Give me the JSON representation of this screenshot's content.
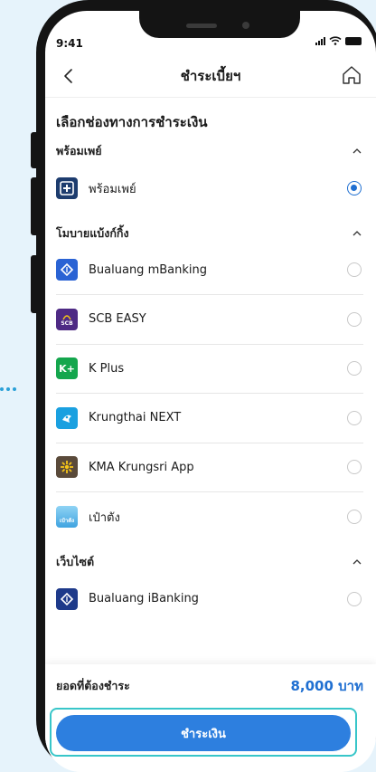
{
  "status": {
    "time": "9:41"
  },
  "nav": {
    "title": "ชำระเบี้ยฯ"
  },
  "page": {
    "section_title": "เลือกช่องทางการชำระเงิน"
  },
  "groups": [
    {
      "title": "พร้อมเพย์",
      "items": [
        {
          "label": "พร้อมเพย์",
          "icon": "promptpay-logo",
          "color": "#1d3c6e",
          "selected": true
        }
      ]
    },
    {
      "title": "โมบายแบ้งก์กิ้ง",
      "items": [
        {
          "label": "Bualuang mBanking",
          "icon": "bualuang-logo",
          "color": "#2a63d4",
          "selected": false
        },
        {
          "label": "SCB EASY",
          "icon": "scb-logo",
          "color": "#4e2a84",
          "selected": false
        },
        {
          "label": "K Plus",
          "icon": "kplus-logo",
          "color": "#14a64d",
          "selected": false
        },
        {
          "label": "Krungthai NEXT",
          "icon": "krungthai-logo",
          "color": "#1aa0e0",
          "selected": false
        },
        {
          "label": "KMA Krungsri App",
          "icon": "krungsri-logo",
          "color": "#5a4a3a",
          "selected": false
        },
        {
          "label": "เป๋าตัง",
          "icon": "paotang-logo",
          "color": "#3fa3e0",
          "selected": false
        }
      ]
    },
    {
      "title": "เว็บไซต์",
      "items": [
        {
          "label": "Bualuang iBanking",
          "icon": "bualuang-logo",
          "color": "#1e3a8a",
          "selected": false
        }
      ]
    }
  ],
  "logo_text": {
    "scb": "SCB",
    "kplus": "K+",
    "paotang": "เป๋าตัง"
  },
  "footer": {
    "amount_label": "ยอดที่ต้องชำระ",
    "amount_value": "8,000 บาท",
    "pay_label": "ชำระเงิน"
  },
  "colors": {
    "accent": "#1f6fd1",
    "button": "#2d7fdf",
    "highlight": "#38c6c9"
  }
}
